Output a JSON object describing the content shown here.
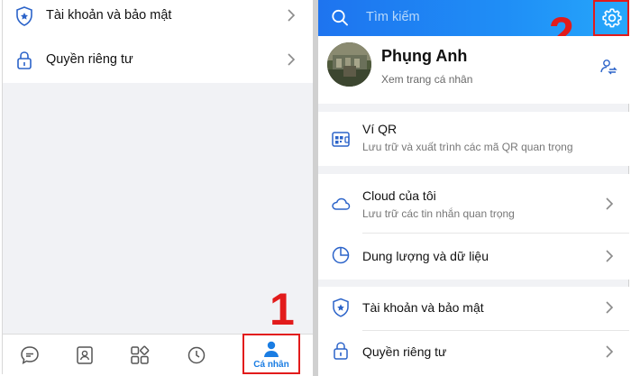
{
  "left": {
    "settings_items": [
      {
        "label": "Tài khoản và bảo mật",
        "icon": "shield-icon"
      },
      {
        "label": "Quyền riêng tư",
        "icon": "lock-icon"
      }
    ],
    "bottom_nav": [
      {
        "icon": "message-icon"
      },
      {
        "icon": "contacts-icon"
      },
      {
        "icon": "discover-grid-icon"
      },
      {
        "icon": "timeline-clock-icon"
      },
      {
        "icon": "profile-person-icon",
        "label": "Cá nhân",
        "active": true
      }
    ],
    "annotation_number": "1"
  },
  "right": {
    "search": {
      "placeholder": "Tìm kiếm"
    },
    "annotation_number": "2",
    "profile": {
      "name": "Phụng Anh",
      "subtitle": "Xem trang cá nhân"
    },
    "items": [
      {
        "title": "Ví QR",
        "subtitle": "Lưu trữ và xuất trình các mã QR quan trọng",
        "icon": "qr-wallet-icon"
      },
      {
        "title": "Cloud của tôi",
        "subtitle": "Lưu trữ các tin nhắn quan trọng",
        "icon": "cloud-icon"
      },
      {
        "title": "Dung lượng và dữ liệu",
        "icon": "pie-chart-icon"
      },
      {
        "title": "Tài khoản và bảo mật",
        "icon": "shield-icon"
      },
      {
        "title": "Quyền riêng tư",
        "icon": "lock-icon"
      }
    ]
  },
  "colors": {
    "accent": "#1a7de3",
    "topbar_start": "#1e74ef",
    "topbar_end": "#26a7fb",
    "annotation_red": "#e21b1b",
    "background_gray": "#f1f2f5"
  }
}
